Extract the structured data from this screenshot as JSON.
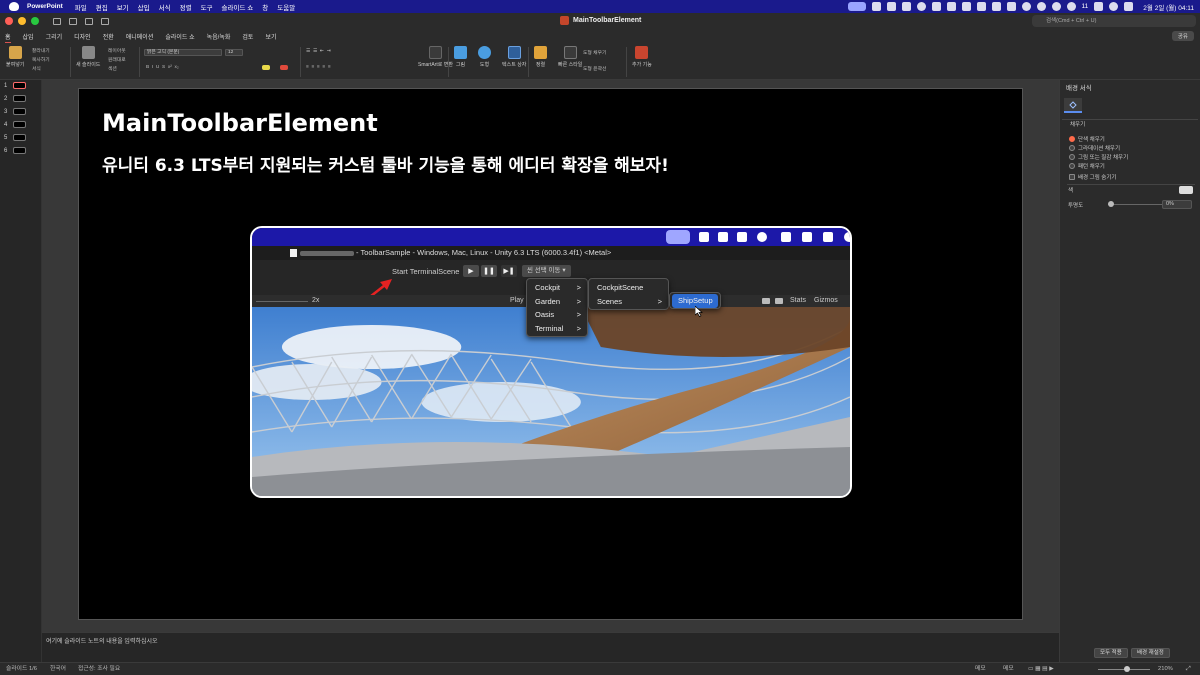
{
  "menubar": {
    "app_name": "PowerPoint",
    "menus": [
      "파일",
      "편집",
      "보기",
      "삽입",
      "서식",
      "정렬",
      "도구",
      "슬라이드 쇼",
      "창",
      "도움말"
    ],
    "battery_count": "11",
    "clock": "2월 2일 (월) 04:11"
  },
  "window": {
    "title": "MainToolbarElement",
    "search_placeholder": "검색(Cmd + Ctrl + U)"
  },
  "ribbon": {
    "tabs": [
      "홈",
      "삽입",
      "그리기",
      "디자인",
      "전환",
      "애니메이션",
      "슬라이드 쇼",
      "녹음/녹화",
      "검토",
      "보기"
    ],
    "share_label": "공유",
    "paste_label": "붙여넣기",
    "cut_label": "잘라내기",
    "copy_label": "복사하기",
    "format_label": "서식",
    "new_slide_label": "새 슬라이드",
    "layout_label": "레이아웃",
    "reset_label": "원래대로",
    "section_label": "섹션",
    "font_name": "맑은 고딕 (본문)",
    "font_size": "12",
    "smartart_label": "SmartArt로 변환",
    "picture_label": "그림",
    "shapes_label": "도형",
    "textbox_label": "텍스트 상자",
    "arrange_label": "정렬",
    "quick_styles_label": "빠른 스타일",
    "shape_fill_label": "도형 채우기",
    "shape_outline_label": "도형 윤곽선",
    "addins_label": "추가 기능"
  },
  "thumbnails": [
    "1",
    "2",
    "3",
    "4",
    "5",
    "6"
  ],
  "slide": {
    "title": "MainToolbarElement",
    "subtitle": "유니티 6.3 LTS부터 지원되는 커스텀 툴바 기능을 통해 에디터 확장을 해보자!"
  },
  "screenshot": {
    "window_title": "- ToolbarSample - Windows, Mac, Linux - Unity 6.3 LTS (6000.3.4f1) <Metal>",
    "start_label": "Start TerminalScene",
    "play_icon": "▶",
    "pause_icon": "❚❚",
    "step_icon": "▶❚",
    "scene_dropdown": "씬 선택 이동 ▾",
    "zoom_label": "2x",
    "play_label": "Play",
    "stats_label": "Stats",
    "gizmos_label": "Gizmos",
    "menu1": [
      {
        "label": "Cockpit",
        "chev": ">"
      },
      {
        "label": "Garden",
        "chev": ">"
      },
      {
        "label": "Oasis",
        "chev": ">"
      },
      {
        "label": "Terminal",
        "chev": ">"
      }
    ],
    "menu2": [
      {
        "label": "CockpitScene",
        "chev": ""
      },
      {
        "label": "Scenes",
        "chev": ">"
      }
    ],
    "menu3": [
      {
        "label": "ShipSetup"
      }
    ],
    "arrow_color": "#e52222",
    "highlight_color": "#2d6bd0"
  },
  "notes": {
    "placeholder": "여기에 슬라이드 노트의 내용을 입력하십시오"
  },
  "pane": {
    "title": "배경 서식",
    "section": "채우기",
    "options": [
      "단색 채우기",
      "그라데이션 채우기",
      "그림 또는 질감 채우기",
      "패턴 채우기"
    ],
    "selected_index": 0,
    "hide_bg_label": "배경 그림 숨기기",
    "color_label": "색",
    "transparency_label": "투명도",
    "transparency_value": "0%",
    "apply_all_label": "모두 적용",
    "reset_bg_label": "배경 재설정"
  },
  "status": {
    "slide_count": "슬라이드 1/6",
    "language": "한국어",
    "accessibility": "접근성: 조사 필요",
    "notes_label": "메모",
    "comments_label": "메모",
    "zoom": "210%"
  }
}
